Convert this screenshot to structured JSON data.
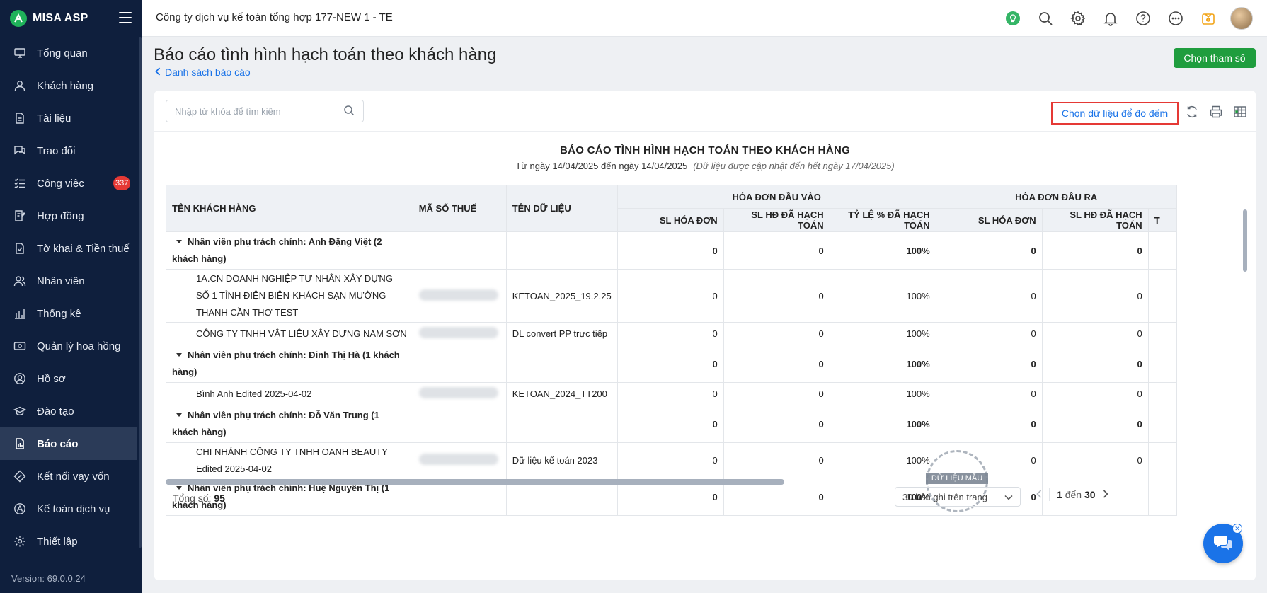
{
  "app": {
    "name": "MISA ASP",
    "version": "Version: 69.0.0.24"
  },
  "topbar": {
    "company": "Công ty dịch vụ kế toán tổng hợp 177-NEW 1 - TE"
  },
  "sidebar": {
    "items": [
      {
        "label": "Tổng quan",
        "icon": "monitor-icon"
      },
      {
        "label": "Khách hàng",
        "icon": "user-icon"
      },
      {
        "label": "Tài liệu",
        "icon": "document-icon"
      },
      {
        "label": "Trao đổi",
        "icon": "chat-icon"
      },
      {
        "label": "Công việc",
        "icon": "tasks-icon",
        "badge": "337"
      },
      {
        "label": "Hợp đồng",
        "icon": "contract-icon"
      },
      {
        "label": "Tờ khai & Tiền thuế",
        "icon": "tax-form-icon"
      },
      {
        "label": "Nhân viên",
        "icon": "employees-icon"
      },
      {
        "label": "Thống kê",
        "icon": "statistics-icon"
      },
      {
        "label": "Quản lý hoa hồng",
        "icon": "commission-icon"
      },
      {
        "label": "Hồ sơ",
        "icon": "profile-icon"
      },
      {
        "label": "Đào tạo",
        "icon": "training-icon"
      },
      {
        "label": "Báo cáo",
        "icon": "report-icon",
        "active": true
      },
      {
        "label": "Kết nối vay vốn",
        "icon": "loan-icon"
      },
      {
        "label": "Kế toán dịch vụ",
        "icon": "accounting-icon"
      },
      {
        "label": "Thiết lập",
        "icon": "settings-icon"
      }
    ]
  },
  "header": {
    "title": "Báo cáo tình hình hạch toán theo khách hàng",
    "back_link": "Danh sách báo cáo",
    "param_button": "Chọn tham số"
  },
  "toolbar": {
    "search_placeholder": "Nhập từ khóa để tìm kiếm",
    "pick_data": "Chọn dữ liệu để đo đếm"
  },
  "report": {
    "title": "BÁO CÁO TÌNH HÌNH HẠCH TOÁN THEO KHÁCH HÀNG",
    "period": "Từ ngày 14/04/2025 đến ngày 14/04/2025",
    "note": "(Dữ liệu được cập nhật đến hết ngày 17/04/2025)"
  },
  "table": {
    "col_customer": "TÊN KHÁCH HÀNG",
    "col_tax": "MÃ SỐ THUẾ",
    "col_data": "TÊN DỮ LIỆU",
    "group_in": "HÓA ĐƠN ĐẦU VÀO",
    "group_out": "HÓA ĐƠN ĐẦU RA",
    "sub_count": "SL HÓA ĐƠN",
    "sub_posted": "SL HĐ ĐÃ HẠCH TOÁN",
    "sub_rate": "TỶ LỆ % ĐÃ HẠCH TOÁN",
    "sub_out_count": "SL HÓA ĐƠN",
    "sub_out_posted": "SL HĐ ĐÃ HẠCH TOÁN",
    "sub_out_rate_partial": "T",
    "rows": [
      {
        "name": "Nhân viên phụ trách chính: Anh Đặng Việt (2 khách hàng)",
        "data": "",
        "in_count": "0",
        "in_posted": "0",
        "in_rate": "100%",
        "out_count": "0",
        "out_posted": "0"
      },
      {
        "name": "1A.CN DOANH NGHIỆP TƯ NHÂN XÂY DỰNG SỐ 1 TỈNH ĐIỆN BIÊN-KHÁCH SẠN MƯỜNG THANH CẦN THƠ TEST",
        "data": "KETOAN_2025_19.2.25",
        "in_count": "0",
        "in_posted": "0",
        "in_rate": "100%",
        "out_count": "0",
        "out_posted": "0"
      },
      {
        "name": "CÔNG TY TNHH VẬT LIỆU XÂY DỰNG NAM SƠN",
        "data": "DL convert PP trực tiếp",
        "in_count": "0",
        "in_posted": "0",
        "in_rate": "100%",
        "out_count": "0",
        "out_posted": "0"
      },
      {
        "name": "Nhân viên phụ trách chính: Đinh Thị Hà (1 khách hàng)",
        "data": "",
        "in_count": "0",
        "in_posted": "0",
        "in_rate": "100%",
        "out_count": "0",
        "out_posted": "0"
      },
      {
        "name": "Bình Anh Edited 2025-04-02",
        "data": "KETOAN_2024_TT200",
        "in_count": "0",
        "in_posted": "0",
        "in_rate": "100%",
        "out_count": "0",
        "out_posted": "0"
      },
      {
        "name": "Nhân viên phụ trách chính: Đỗ Văn Trung (1 khách hàng)",
        "data": "",
        "in_count": "0",
        "in_posted": "0",
        "in_rate": "100%",
        "out_count": "0",
        "out_posted": "0"
      },
      {
        "name": "CHI NHÁNH CÔNG TY TNHH OANH BEAUTY Edited 2025-04-02",
        "data": "Dữ liệu kế toán 2023",
        "in_count": "0",
        "in_posted": "0",
        "in_rate": "100%",
        "out_count": "0",
        "out_posted": "0"
      },
      {
        "name": "Nhân viên phụ trách chính: Huệ Nguyễn Thị (1 khách hàng)",
        "data": "",
        "in_count": "0",
        "in_posted": "0",
        "in_rate": "100%",
        "out_count": "0",
        "out_posted": ""
      }
    ]
  },
  "footer": {
    "total_label": "Tổng số:",
    "total_value": "95",
    "page_size": "30 bản ghi trên trang",
    "range_from": "1",
    "range_sep": "đến",
    "range_to": "30"
  },
  "watermark": "DỮ LIỆU MẪU",
  "colors": {
    "sidebar": "#0f1f3d",
    "accent_green": "#1f9d3e",
    "link_blue": "#1a73e8",
    "highlight_red": "#e53935"
  }
}
